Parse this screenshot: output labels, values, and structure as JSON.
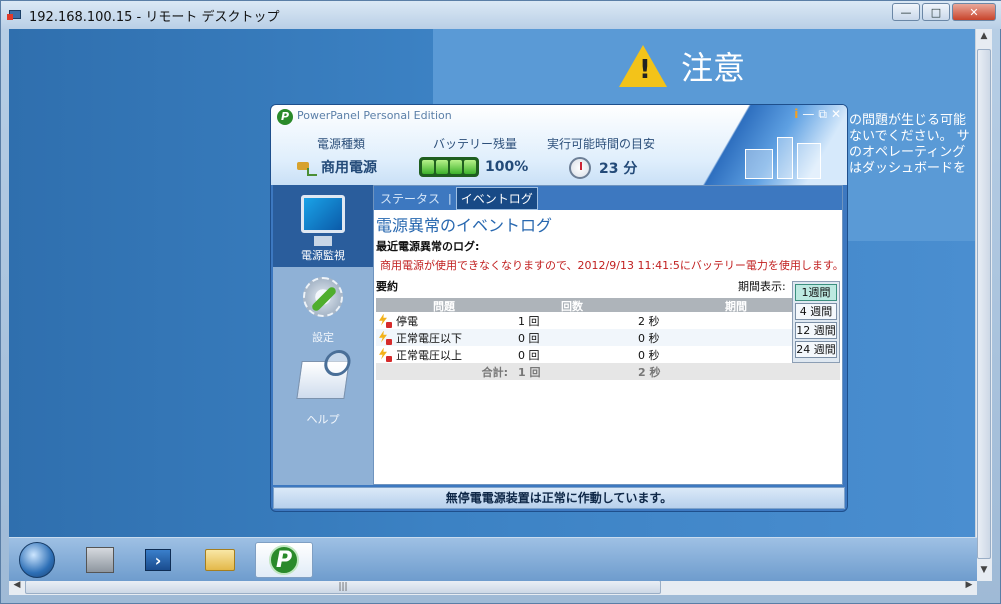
{
  "rd_window": {
    "title": "192.168.100.15 - リモート デスクトップ",
    "minimize": "—",
    "maximize": "□",
    "close": "✕"
  },
  "desktop": {
    "warning_title": "注意",
    "warning_glyph": "!",
    "bg_lines": [
      "の問題が生じる可能",
      "ないでください。 サ",
      "のオペレーティング",
      "はダッシュボードを"
    ]
  },
  "powerpanel": {
    "title": "PowerPanel Personal Edition",
    "header": {
      "power_type_label": "電源種類",
      "power_type_value": "商用電源",
      "battery_label": "バッテリー残量",
      "battery_value": "100%",
      "battery_level_percent": 100,
      "runtime_label": "実行可能時間の目安",
      "runtime_value": "23 分"
    },
    "sidebar": {
      "items": [
        {
          "label": "電源監視",
          "icon": "monitor-icon"
        },
        {
          "label": "設定",
          "icon": "settings-icon"
        },
        {
          "label": "ヘルプ",
          "icon": "help-icon"
        }
      ]
    },
    "tabs": {
      "status": "ステータス",
      "separator": "|",
      "event_log": "イベントログ"
    },
    "section_title": "電源異常のイベントログ",
    "recent_log_label": "最近電源異常のログ:",
    "recent_log_message": "商用電源が使用できなくなりますので、2012/9/13 11:41:5にバッテリー電力を使用します。",
    "summary_label": "要約",
    "period_label": "期間表示:",
    "period_options": [
      "1週間",
      "4 週間",
      "12 週間",
      "24 週間"
    ],
    "table": {
      "headers": [
        "問題",
        "回数",
        "期間"
      ],
      "rows": [
        {
          "problem": "停電",
          "count": "1 回",
          "duration": "2 秒"
        },
        {
          "problem": "正常電圧以下",
          "count": "0 回",
          "duration": "0 秒"
        },
        {
          "problem": "正常電圧以上",
          "count": "0 回",
          "duration": "0 秒"
        }
      ],
      "total": {
        "label": "合計:",
        "count": "1 回",
        "duration": "2 秒"
      }
    },
    "status_bar": "無停電電源装置は正常に作動しています。"
  },
  "taskbar": {
    "items": [
      "start-orb",
      "server-manager",
      "powershell",
      "explorer",
      "powerpanel"
    ]
  }
}
